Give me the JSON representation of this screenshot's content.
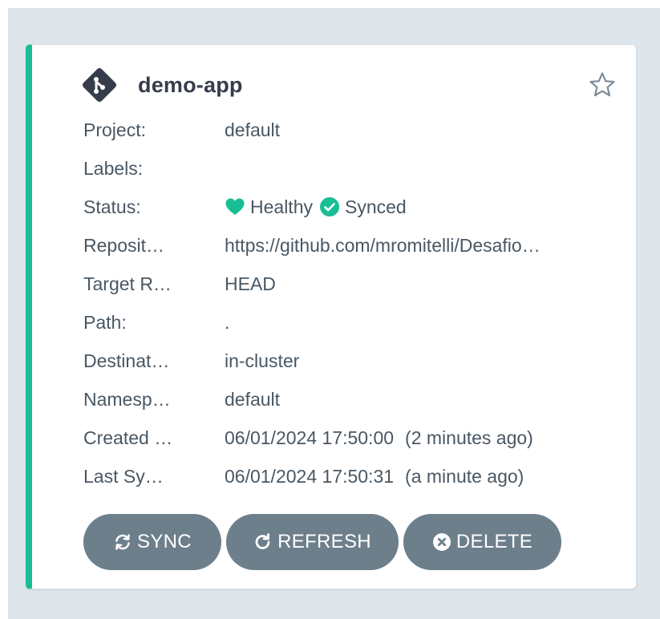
{
  "app": {
    "name": "demo-app",
    "icon": "git-diamond-icon",
    "favorite_icon": "star-outline-icon"
  },
  "fields": {
    "project_label": "Project:",
    "project_value": "default",
    "labels_label": "Labels:",
    "labels_value": "",
    "status_label": "Status:",
    "health_text": "Healthy",
    "sync_text": "Synced",
    "repo_label": "Reposit…",
    "repo_value": "https://github.com/mromitelli/Desafio…",
    "target_label": "Target R…",
    "target_value": "HEAD",
    "path_label": "Path:",
    "path_value": ".",
    "destination_label": "Destinat…",
    "destination_value": "in-cluster",
    "namespace_label": "Namesp…",
    "namespace_value": "default",
    "created_label": "Created …",
    "created_ts": "06/01/2024 17:50:00",
    "created_rel": "(2 minutes ago)",
    "lastsync_label": "Last Sy…",
    "lastsync_ts": "06/01/2024 17:50:31",
    "lastsync_rel": "(a minute ago)"
  },
  "actions": {
    "sync": "SYNC",
    "refresh": "REFRESH",
    "delete": "DELETE"
  },
  "colors": {
    "accent": "#18be94",
    "button_bg": "#6d7f8b",
    "text": "#495763",
    "title": "#363c4a"
  }
}
